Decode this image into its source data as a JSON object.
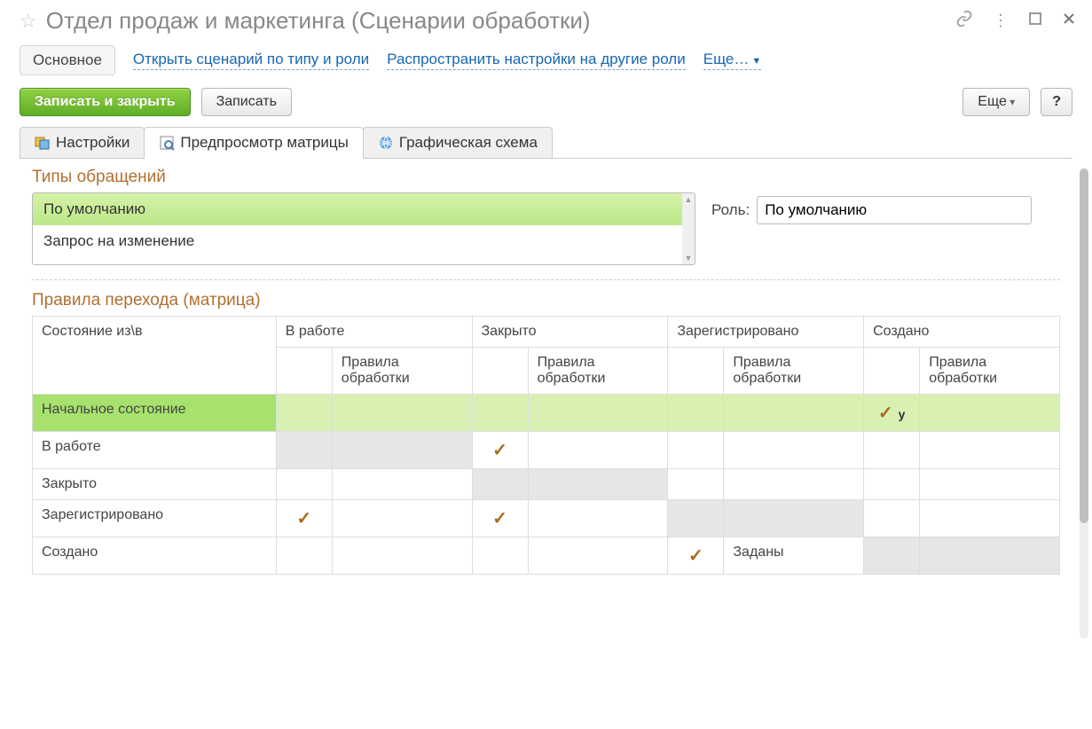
{
  "title": "Отдел продаж и маркетинга (Сценарии обработки)",
  "linkbar": {
    "main_tab": "Основное",
    "open_scenario": "Открыть сценарий по типу и роли",
    "propagate": "Распространить настройки на другие роли",
    "more": "Еще…"
  },
  "toolbar": {
    "save_close": "Записать и закрыть",
    "save": "Записать",
    "more": "Еще",
    "help": "?"
  },
  "tabs": {
    "settings": "Настройки",
    "preview": "Предпросмотр матрицы",
    "graph": "Графическая схема"
  },
  "types": {
    "title": "Типы обращений",
    "items": [
      "По умолчанию",
      "Запрос на изменение"
    ],
    "role_label": "Роль:",
    "role_value": "По умолчанию"
  },
  "matrix": {
    "title": "Правила перехода (матрица)",
    "header_fromto": "Состояние из\\в",
    "columns": [
      "В работе",
      "Закрыто",
      "Зарегистрировано",
      "Создано"
    ],
    "sub_rules": "Правила обработки",
    "sub_y": "у",
    "rows": [
      {
        "label": "Начальное состояние",
        "initial": true,
        "cells": [
          {
            "c": "",
            "r": ""
          },
          {
            "c": "",
            "r": ""
          },
          {
            "c": "",
            "r": ""
          },
          {
            "c": "check_y",
            "r": ""
          }
        ]
      },
      {
        "label": "В работе",
        "cells": [
          {
            "c": "grey",
            "r": "grey"
          },
          {
            "c": "check",
            "r": ""
          },
          {
            "c": "",
            "r": ""
          },
          {
            "c": "",
            "r": ""
          }
        ]
      },
      {
        "label": "Закрыто",
        "cells": [
          {
            "c": "",
            "r": ""
          },
          {
            "c": "grey",
            "r": "grey"
          },
          {
            "c": "",
            "r": ""
          },
          {
            "c": "",
            "r": ""
          }
        ]
      },
      {
        "label": "Зарегистрировано",
        "cells": [
          {
            "c": "check",
            "r": ""
          },
          {
            "c": "check",
            "r": ""
          },
          {
            "c": "grey",
            "r": "grey"
          },
          {
            "c": "",
            "r": ""
          }
        ]
      },
      {
        "label": "Создано",
        "cells": [
          {
            "c": "",
            "r": ""
          },
          {
            "c": "",
            "r": ""
          },
          {
            "c": "check",
            "r": "Заданы"
          },
          {
            "c": "grey",
            "r": "grey"
          }
        ]
      }
    ],
    "rule_set_text": "Заданы"
  }
}
